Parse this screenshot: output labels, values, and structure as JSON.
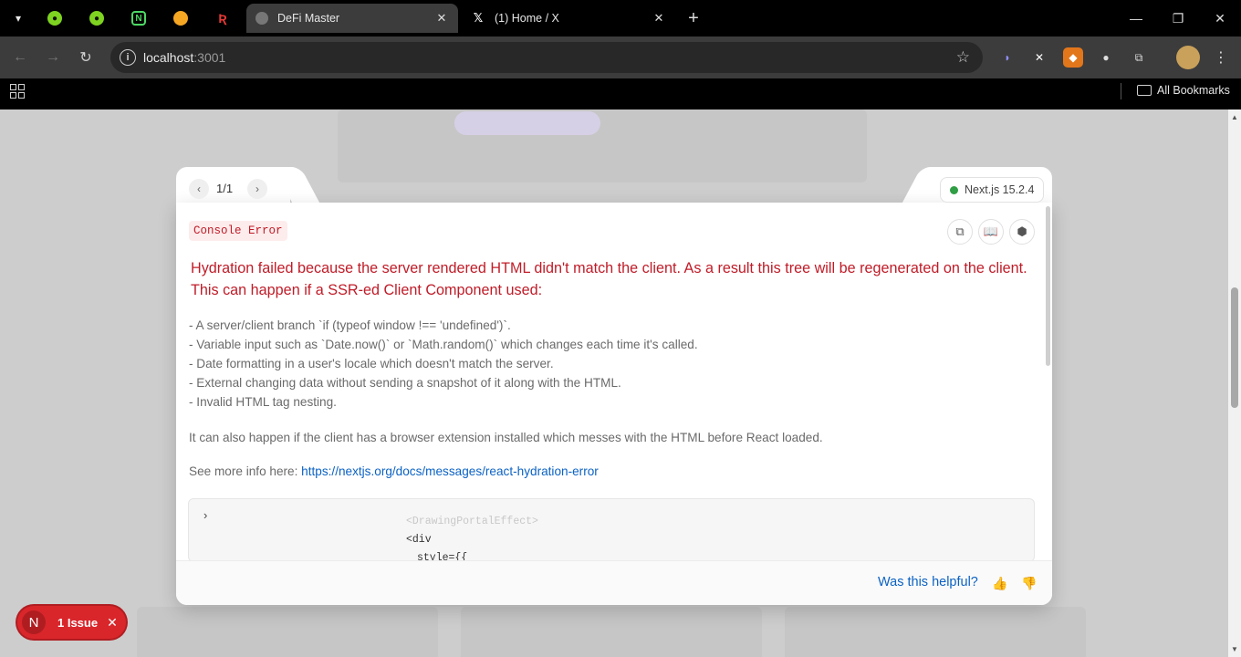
{
  "browser": {
    "tabs": [
      {
        "title": "DeFi Master",
        "active": true
      },
      {
        "title": "(1) Home / X",
        "active": false
      }
    ],
    "address": {
      "host": "localhost",
      "port": ":3001"
    },
    "bookmarks_label": "All Bookmarks"
  },
  "error_overlay": {
    "pager": "1/1",
    "version": "Next.js 15.2.4",
    "badge": "Console Error",
    "heading": "Hydration failed because the server rendered HTML didn't match the client. As a result this tree will be regenerated on the client. This can happen if a SSR-ed Client Component used:",
    "bullets": [
      "- A server/client branch `if (typeof window !== 'undefined')`.",
      "- Variable input such as `Date.now()` or `Math.random()` which changes each time it's called.",
      "- Date formatting in a user's locale which doesn't match the server.",
      "- External changing data without sending a snapshot of it along with the HTML.",
      "- Invalid HTML tag nesting."
    ],
    "extension_note": "It can also happen if the client has a browser extension installed which messes with the HTML before React loaded.",
    "more_info_prefix": "See more info here: ",
    "more_info_link": "https://nextjs.org/docs/messages/react-hydration-error",
    "code_lines": [
      "<DrawingPortalEffect>",
      "<div",
      "style={{"
    ],
    "helpful_prompt": "Was this helpful?"
  },
  "issue_badge": {
    "initial": "N",
    "label": "1 Issue"
  },
  "colors": {
    "error_red": "#c01c28",
    "link_blue": "#0b62c4",
    "ok_green": "#2f9e44"
  }
}
